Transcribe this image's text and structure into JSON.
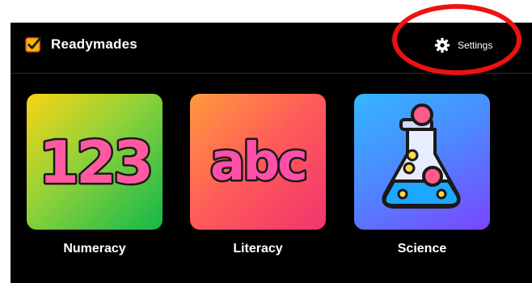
{
  "app": {
    "brand": "Readymades",
    "accent": "#f5b800"
  },
  "header": {
    "settings_label": "Settings",
    "settings_icon": "gear-icon"
  },
  "subjects": [
    {
      "label": "Numeracy",
      "art_text": "123",
      "icon": "numbers-123-icon"
    },
    {
      "label": "Literacy",
      "art_text": "abc",
      "icon": "letters-abc-icon"
    },
    {
      "label": "Science",
      "art_text": "",
      "icon": "flask-icon"
    }
  ],
  "annotation": {
    "color": "#ee1111",
    "target": "settings-button"
  }
}
